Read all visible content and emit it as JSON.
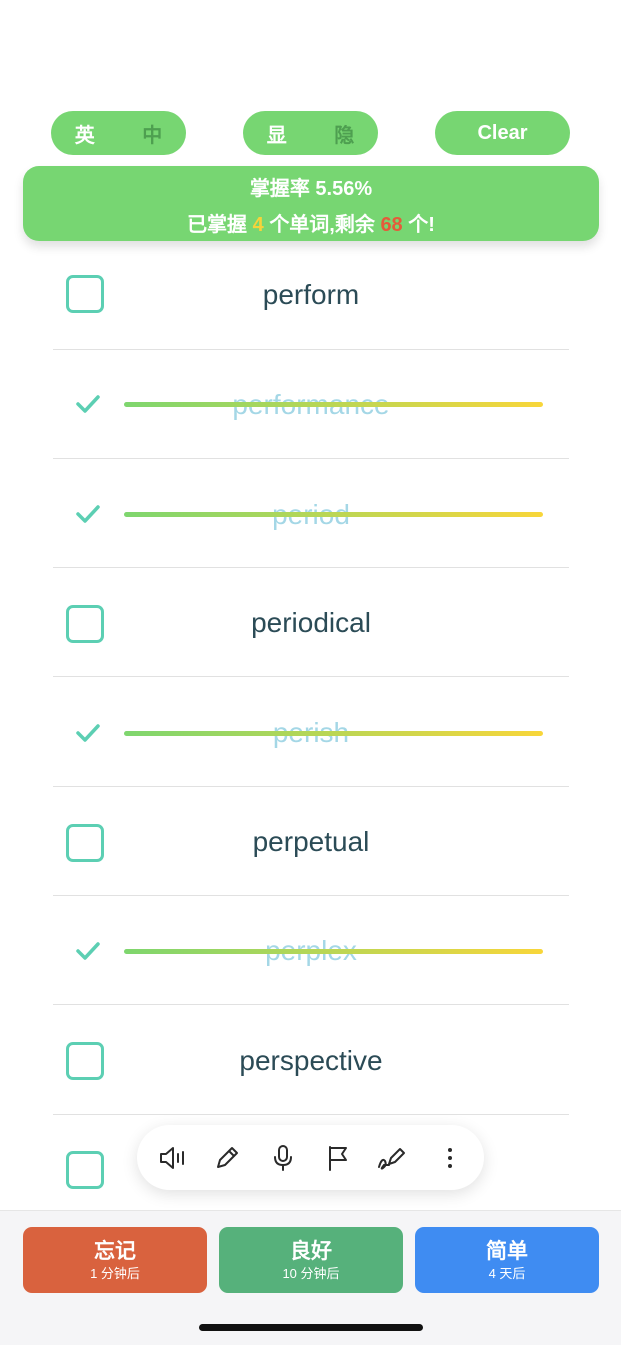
{
  "top_buttons": {
    "lang": {
      "left": "英",
      "right": "中"
    },
    "visibility": {
      "left": "显",
      "right": "隐"
    },
    "clear": "Clear"
  },
  "stats": {
    "rate_text": "掌握率 5.56%",
    "prefix": "已掌握",
    "mastered": "4",
    "middle": "个单词,剩余",
    "remaining": "68",
    "suffix": "个!"
  },
  "words": [
    {
      "text": "perform",
      "mastered": false
    },
    {
      "text": "performance",
      "mastered": true
    },
    {
      "text": "period",
      "mastered": true
    },
    {
      "text": "periodical",
      "mastered": false
    },
    {
      "text": "perish",
      "mastered": true
    },
    {
      "text": "perpetual",
      "mastered": false
    },
    {
      "text": "perplex",
      "mastered": true
    },
    {
      "text": "perspective",
      "mastered": false
    }
  ],
  "toolbar_icons": [
    "speaker-icon",
    "pencil-icon",
    "microphone-icon",
    "flag-icon",
    "signature-icon",
    "more-vertical-icon"
  ],
  "ratings": [
    {
      "title": "忘记",
      "subtitle": "1 分钟后",
      "color": "#d9623e"
    },
    {
      "title": "良好",
      "subtitle": "10 分钟后",
      "color": "#56b17b"
    },
    {
      "title": "简单",
      "subtitle": "4 天后",
      "color": "#3f8cf2"
    }
  ]
}
